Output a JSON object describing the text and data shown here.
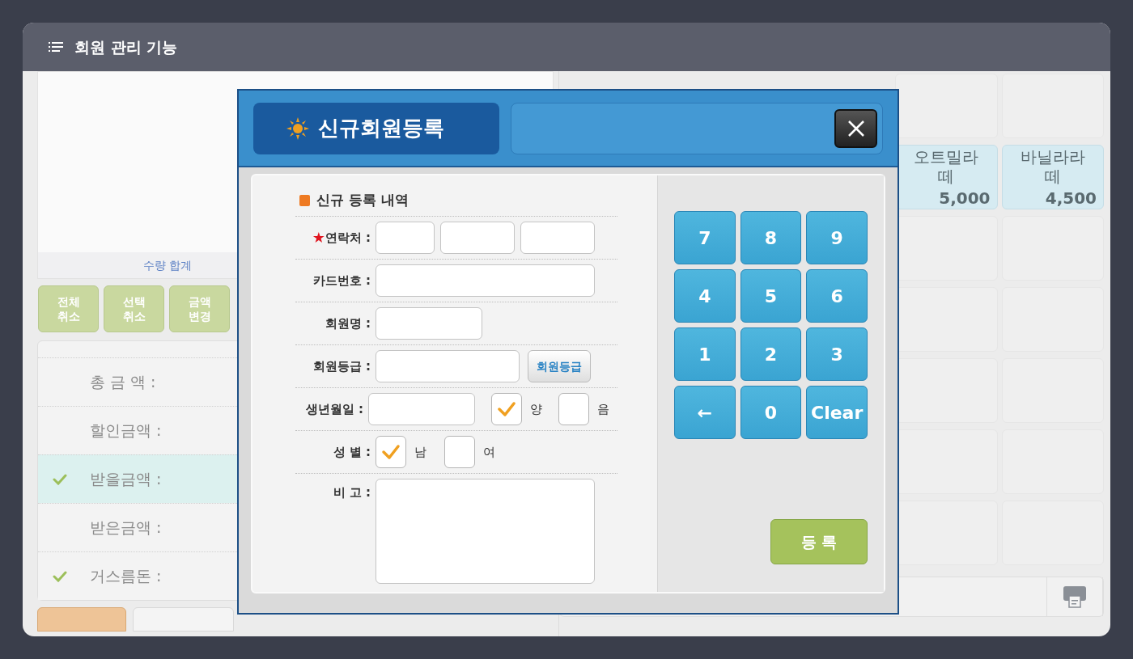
{
  "window": {
    "title": "회원 관리 기능"
  },
  "order_panel": {
    "quantity_label": "수량 합계",
    "action_buttons": [
      {
        "lines": [
          "전체",
          "취소"
        ]
      },
      {
        "lines": [
          "선택",
          "취소"
        ]
      },
      {
        "lines": [
          "금액",
          "변경"
        ]
      }
    ],
    "summary_rows": [
      {
        "label": "총 금 액 :",
        "checked": false,
        "selected": false
      },
      {
        "label": "할인금액 :",
        "checked": false,
        "selected": false
      },
      {
        "label": "받을금액 :",
        "checked": true,
        "selected": true
      },
      {
        "label": "받은금액 :",
        "checked": false,
        "selected": false
      },
      {
        "label": "거스름돈 :",
        "checked": true,
        "selected": false
      }
    ]
  },
  "products": [
    {
      "name": "오트밀라떼",
      "price": "5,000"
    },
    {
      "name": "바닐라라떼",
      "price": "4,500"
    }
  ],
  "dialog": {
    "title": "신규회원등록",
    "section_title": "신규 등록 내역",
    "rows": [
      {
        "kind": "contact",
        "label": "연락처 :",
        "marker": "★"
      },
      {
        "kind": "wide",
        "label": "카드번호 :"
      },
      {
        "kind": "short",
        "label": "회원명 :"
      },
      {
        "kind": "grade",
        "label": "회원등급 :",
        "button": "회원등급"
      },
      {
        "kind": "birth",
        "label": "생년월일 :",
        "options": [
          {
            "label": "양",
            "checked": true
          },
          {
            "label": "음",
            "checked": false
          }
        ]
      },
      {
        "kind": "gender",
        "label": "성 별 :",
        "options": [
          {
            "label": "남",
            "checked": true
          },
          {
            "label": "여",
            "checked": false
          }
        ]
      },
      {
        "kind": "memo",
        "label": "비 고 :"
      }
    ],
    "keys": [
      "7",
      "8",
      "9",
      "4",
      "5",
      "6",
      "1",
      "2",
      "3",
      "←",
      "0",
      "Clear"
    ],
    "submit": "등 록"
  }
}
